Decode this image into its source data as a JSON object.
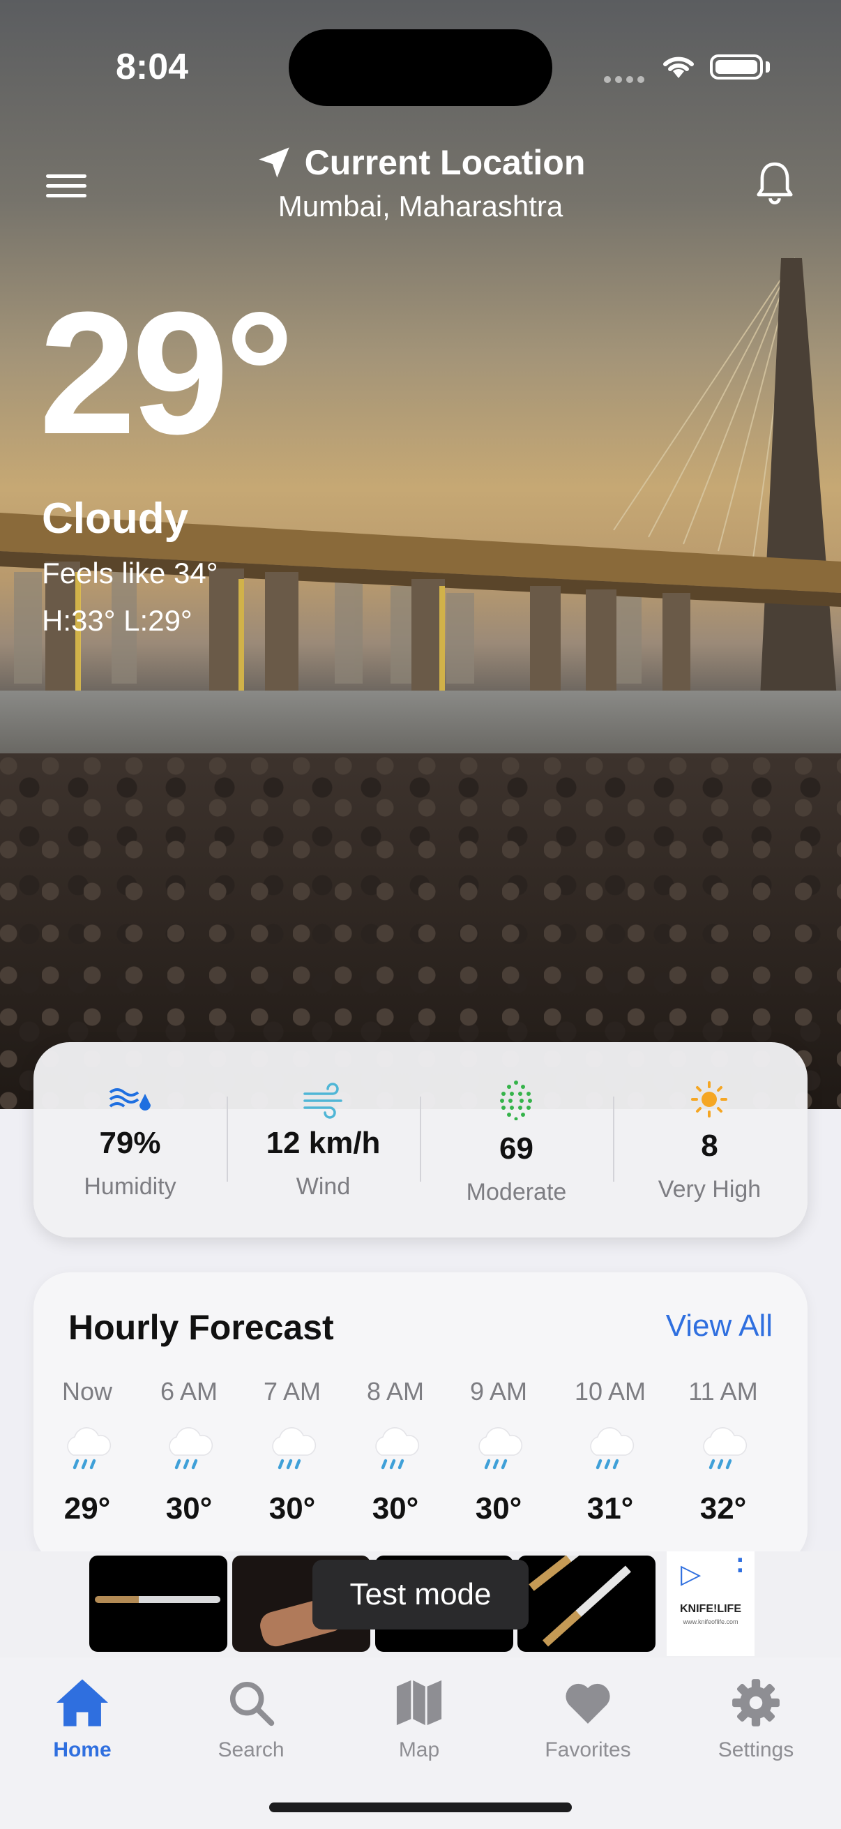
{
  "status": {
    "time": "8:04"
  },
  "header": {
    "title": "Current Location",
    "subtitle": "Mumbai, Maharashtra"
  },
  "current": {
    "temp": "29°",
    "condition": "Cloudy",
    "feels_like": "Feels like 34°",
    "hi_lo": "H:33°  L:29°"
  },
  "stats": [
    {
      "value": "79%",
      "label": "Humidity",
      "icon": "humidity-icon"
    },
    {
      "value": "12 km/h",
      "label": "Wind",
      "icon": "wind-icon"
    },
    {
      "value": "69",
      "label": "Moderate",
      "icon": "aqi-icon"
    },
    {
      "value": "8",
      "label": "Very High",
      "icon": "uv-sun-icon"
    }
  ],
  "hourly": {
    "title": "Hourly Forecast",
    "view_all": "View All",
    "items": [
      {
        "time": "Now",
        "temp": "29°",
        "icon": "rain-cloud-icon"
      },
      {
        "time": "6 AM",
        "temp": "30°",
        "icon": "rain-cloud-icon"
      },
      {
        "time": "7 AM",
        "temp": "30°",
        "icon": "rain-cloud-icon"
      },
      {
        "time": "8 AM",
        "temp": "30°",
        "icon": "rain-cloud-icon"
      },
      {
        "time": "9 AM",
        "temp": "30°",
        "icon": "rain-cloud-icon"
      },
      {
        "time": "10 AM",
        "temp": "31°",
        "icon": "rain-cloud-icon"
      },
      {
        "time": "11 AM",
        "temp": "32°",
        "icon": "rain-cloud-icon"
      }
    ]
  },
  "ad": {
    "toast": "Test mode",
    "brand": "KNIFE!LIFE",
    "url": "www.knifeoflife.com"
  },
  "tabs": [
    {
      "label": "Home",
      "icon": "home-icon",
      "active": true
    },
    {
      "label": "Search",
      "icon": "search-icon"
    },
    {
      "label": "Map",
      "icon": "map-icon"
    },
    {
      "label": "Favorites",
      "icon": "heart-icon"
    },
    {
      "label": "Settings",
      "icon": "gear-icon"
    }
  ],
  "colors": {
    "accent": "#2f6fdf",
    "aqi": "#35b34a",
    "uv": "#f5a623",
    "humidity": "#1f6fe0",
    "wind": "#4fb6d6"
  }
}
